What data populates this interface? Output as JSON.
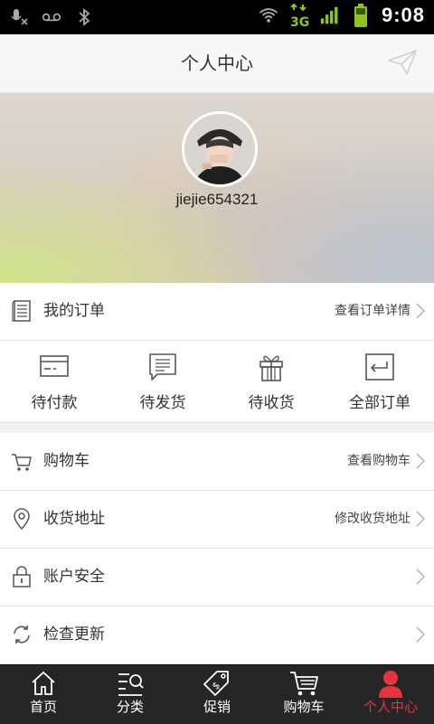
{
  "status_bar": {
    "time": "9:08"
  },
  "header": {
    "title": "个人中心"
  },
  "profile": {
    "username": "jiejie654321"
  },
  "orders": {
    "label": "我的订单",
    "link": "查看订单详情",
    "items": [
      {
        "label": "待付款",
        "icon": "card-icon"
      },
      {
        "label": "待发货",
        "icon": "message-list-icon"
      },
      {
        "label": "待收货",
        "icon": "gift-icon"
      },
      {
        "label": "全部订单",
        "icon": "return-arrow-icon"
      }
    ]
  },
  "menu": [
    {
      "label": "购物车",
      "link": "查看购物车",
      "icon": "cart-icon"
    },
    {
      "label": "收货地址",
      "link": "修改收货地址",
      "icon": "location-pin-icon"
    },
    {
      "label": "账户安全",
      "link": "",
      "icon": "lock-icon"
    },
    {
      "label": "检查更新",
      "link": "",
      "icon": "refresh-icon"
    }
  ],
  "tabs": [
    {
      "label": "首页",
      "icon": "home-icon"
    },
    {
      "label": "分类",
      "icon": "category-search-icon"
    },
    {
      "label": "促销",
      "icon": "tag-icon"
    },
    {
      "label": "购物车",
      "icon": "cart-icon"
    },
    {
      "label": "个人中心",
      "icon": "person-icon",
      "active": true
    }
  ],
  "colors": {
    "accent": "#e8333a",
    "tabbar_bg": "#262626"
  }
}
